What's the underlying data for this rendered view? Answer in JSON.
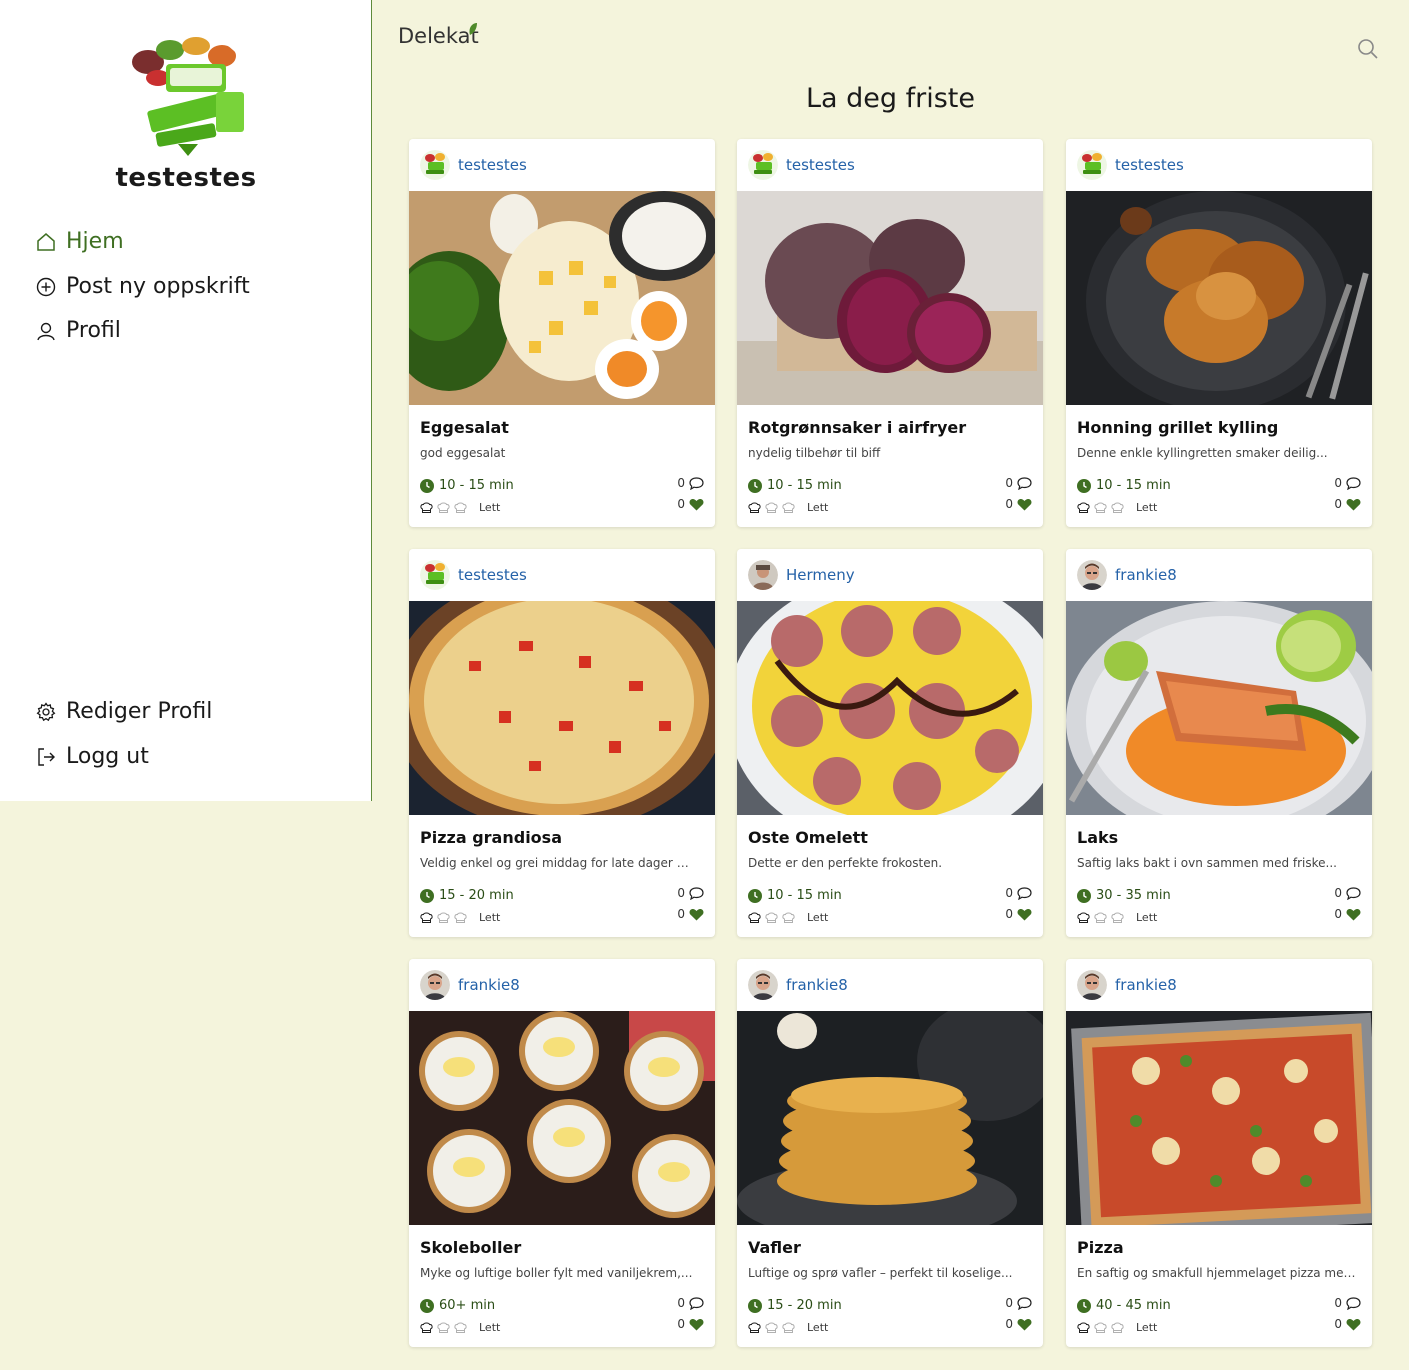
{
  "sidebar": {
    "username": "testestes",
    "nav": [
      {
        "label": "Hjem",
        "icon": "home-icon",
        "active": true
      },
      {
        "label": "Post ny oppskrift",
        "icon": "plus-circle-icon"
      },
      {
        "label": "Profil",
        "icon": "user-icon"
      }
    ],
    "bottom_nav": [
      {
        "label": "Rediger Profil",
        "icon": "gear-icon"
      },
      {
        "label": "Logg ut",
        "icon": "logout-icon"
      }
    ]
  },
  "header": {
    "logo": "Delekat",
    "title": "La deg friste"
  },
  "colors": {
    "background": "#f4f4dc",
    "accent_green": "#3f6f22",
    "link_blue": "#2562a8"
  },
  "recipes": [
    {
      "author": "testestes",
      "title": "Eggesalat",
      "description": "god eggesalat",
      "time": "10 - 15 min",
      "difficulty": "Lett",
      "difficulty_level": 1,
      "comments": "0",
      "likes": "0"
    },
    {
      "author": "testestes",
      "title": "Rotgrønnsaker i airfryer",
      "description": "nydelig tilbehør til biff",
      "time": "10 - 15 min",
      "difficulty": "Lett",
      "difficulty_level": 1,
      "comments": "0",
      "likes": "0"
    },
    {
      "author": "testestes",
      "title": "Honning grillet kylling",
      "description": "Denne enkle kyllingretten smaker deilig...",
      "time": "10 - 15 min",
      "difficulty": "Lett",
      "difficulty_level": 1,
      "comments": "0",
      "likes": "0"
    },
    {
      "author": "testestes",
      "title": "Pizza grandiosa",
      "description": "Veldig enkel og grei middag for late dager ma...",
      "time": "15 - 20 min",
      "difficulty": "Lett",
      "difficulty_level": 1,
      "comments": "0",
      "likes": "0"
    },
    {
      "author": "Hermeny",
      "title": "Oste Omelett",
      "description": "Dette er den perfekte frokosten.",
      "time": "10 - 15 min",
      "difficulty": "Lett",
      "difficulty_level": 1,
      "comments": "0",
      "likes": "0"
    },
    {
      "author": "frankie8",
      "title": "Laks",
      "description": "Saftig laks bakt i ovn sammen med friske...",
      "time": "30 - 35 min",
      "difficulty": "Lett",
      "difficulty_level": 1,
      "comments": "0",
      "likes": "0"
    },
    {
      "author": "frankie8",
      "title": "Skoleboller",
      "description": "Myke og luftige boller fylt med vaniljekrem,...",
      "time": "60+ min",
      "difficulty": "Lett",
      "difficulty_level": 1,
      "comments": "0",
      "likes": "0"
    },
    {
      "author": "frankie8",
      "title": "Vafler",
      "description": "Luftige og sprø vafler – perfekt til koselige...",
      "time": "15 - 20 min",
      "difficulty": "Lett",
      "difficulty_level": 1,
      "comments": "0",
      "likes": "0"
    },
    {
      "author": "frankie8",
      "title": "Pizza",
      "description": "En saftig og smakfull hjemmelaget pizza med...",
      "time": "40 - 45 min",
      "difficulty": "Lett",
      "difficulty_level": 1,
      "comments": "0",
      "likes": "0"
    }
  ]
}
